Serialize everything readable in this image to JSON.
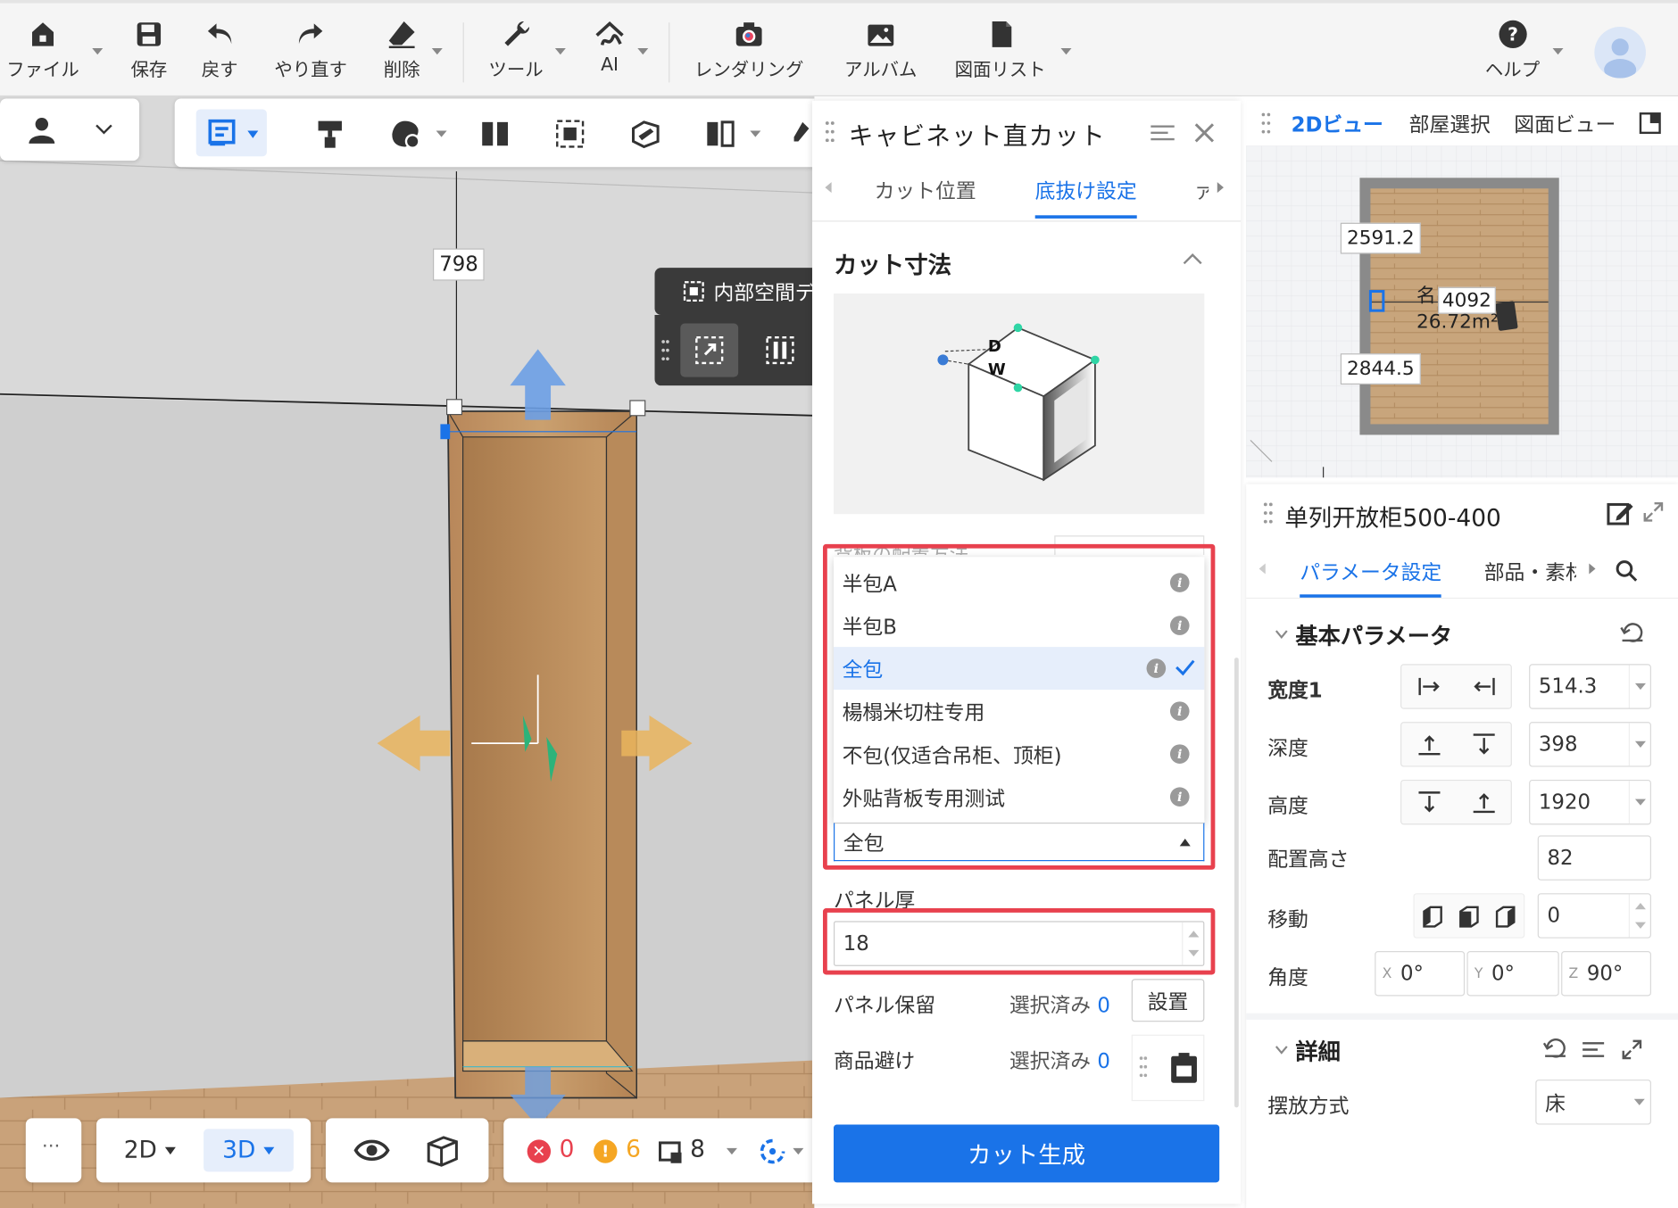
{
  "toolbar": {
    "file": "ファイル",
    "save": "保存",
    "undo": "戻す",
    "redo": "やり直す",
    "delete": "削除",
    "tools": "ツール",
    "ai": "AI",
    "rendering": "レンダリング",
    "album": "アルバム",
    "drawing_list": "図面リスト",
    "help": "ヘルプ"
  },
  "viewport": {
    "dim_top": "798",
    "floating_label": "内部空間デ"
  },
  "panel": {
    "title": "キャビネット直カット",
    "tabs": [
      "カット位置",
      "底抜け設定",
      "ァ"
    ],
    "active_tab": 1,
    "section_title": "カット寸法",
    "diagram_labels": {
      "d": "D",
      "w": "W"
    },
    "hidden_row": "背板の配置方法",
    "dropdown_options": [
      "半包A",
      "半包B",
      "全包",
      "楊榻米切柱专用",
      "不包(仅适合吊柜、顶柜)",
      "外贴背板专用测试"
    ],
    "selected_option": "全包",
    "panel_thickness_label": "パネル厚",
    "panel_thickness_value": "18",
    "panel_keep_label": "パネル保留",
    "panel_keep_selected": "選択済み",
    "panel_keep_count": "0",
    "panel_keep_btn": "設置",
    "avoid_label": "商品避け",
    "avoid_selected": "選択済み",
    "avoid_count": "0",
    "generate_btn": "カット生成"
  },
  "rightTop": {
    "tabs": [
      "2Dビュー",
      "部屋選択",
      "図面ビュー"
    ],
    "dims": [
      "2591.2",
      "4092",
      "2844.5"
    ],
    "room_name": "名",
    "room_area": "26.72m²"
  },
  "rightProp": {
    "title": "单列开放柜500-400",
    "tabs": [
      "パラメータ設定",
      "部品・素材"
    ],
    "section_basic": "基本パラメータ",
    "width_label": "宽度1",
    "width_value": "514.3",
    "depth_label": "深度",
    "depth_value": "398",
    "height_label": "高度",
    "height_value": "1920",
    "place_height_label": "配置高さ",
    "place_height_value": "82",
    "move_label": "移動",
    "move_value": "0",
    "angle_label": "角度",
    "angle_x_label": "X",
    "angle_x": "0°",
    "angle_y_label": "Y",
    "angle_y": "0°",
    "angle_z_label": "Z",
    "angle_z": "90°",
    "section_detail": "詳細",
    "placement_label": "摆放方式",
    "placement_value": "床"
  },
  "bottom": {
    "more": "···",
    "mode_2d": "2D",
    "mode_3d": "3D",
    "errors": "0",
    "warnings": "6",
    "items": "8"
  },
  "colors": {
    "accent": "#1a73e8",
    "red": "#e8414e",
    "warn": "#f5a623",
    "wood": "#c89a64"
  }
}
